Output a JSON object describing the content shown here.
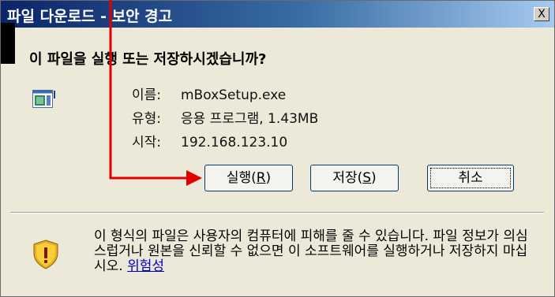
{
  "window": {
    "title": "파일 다운로드 - 보안 경고",
    "close_label": "X"
  },
  "question": "이 파일을 실행 또는 저장하시겠습니까?",
  "file": {
    "name_label": "이름:",
    "name_value": "mBoxSetup.exe",
    "type_label": "유형:",
    "type_value": "응용 프로그램, 1.43MB",
    "from_label": "시작:",
    "from_value": "192.168.123.10",
    "icon": "application-file-icon"
  },
  "buttons": {
    "run": "실행",
    "run_key": "R",
    "save": "저장",
    "save_key": "S",
    "cancel": "취소"
  },
  "warning": {
    "icon": "shield-warning-icon",
    "text": "이 형식의 파일은 사용자의 컴퓨터에 피해를 줄 수 있습니다. 파일 정보가 의심스럽거나 원본을 신뢰할 수 없으면 이 소프트웨어를 실행하거나 저장하지 마십시오.",
    "link": "위험성"
  },
  "colors": {
    "annotation": "#e00000",
    "titlebar": "#0a246a",
    "dialog_bg": "#ece9d8"
  }
}
